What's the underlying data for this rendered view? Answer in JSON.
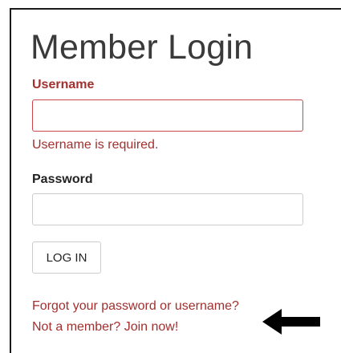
{
  "login": {
    "title": "Member Login",
    "username_label": "Username",
    "username_value": "",
    "username_error": "Username is required.",
    "password_label": "Password",
    "password_value": "",
    "login_button": "LOG IN",
    "forgot_link": "Forgot your password or username?",
    "join_link": "Not a member? Join now!"
  },
  "colors": {
    "error": "#a1302f",
    "title": "#3a3a3a",
    "arrow": "#000000"
  },
  "icons": {
    "pointer": "arrow-left-icon"
  }
}
